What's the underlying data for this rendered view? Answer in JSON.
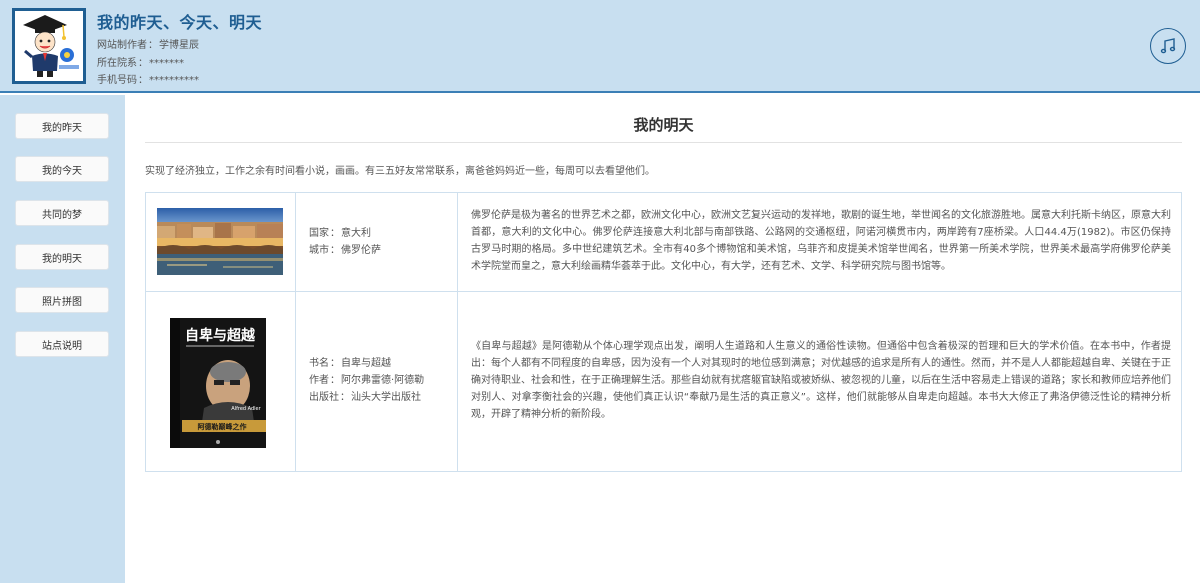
{
  "header": {
    "title": "我的昨天、今天、明天",
    "author_label": "网站制作者",
    "author_value": "学博星辰",
    "dept_label": "所在院系",
    "dept_value": "*******",
    "phone_label": "手机号码",
    "phone_value": "**********",
    "separator": "："
  },
  "sidebar": {
    "items": [
      {
        "label": "我的昨天"
      },
      {
        "label": "我的今天"
      },
      {
        "label": "共同的梦"
      },
      {
        "label": "我的明天"
      },
      {
        "label": "照片拼图"
      },
      {
        "label": "站点说明"
      }
    ]
  },
  "main": {
    "title": "我的明天",
    "intro": "实现了经济独立，工作之余有时间看小说，画画。有三五好友常常联系，离爸爸妈妈近一些，每周可以去看望他们。",
    "rows": [
      {
        "fields": [
          {
            "label": "国家",
            "value": "意大利"
          },
          {
            "label": "城市",
            "value": "佛罗伦萨"
          }
        ],
        "description": "佛罗伦萨是极为著名的世界艺术之都，欧洲文化中心，欧洲文艺复兴运动的发祥地，歌剧的诞生地，举世闻名的文化旅游胜地。属意大利托斯卡纳区，原意大利首都，意大利的文化中心。佛罗伦萨连接意大利北部与南部铁路、公路网的交通枢纽，阿诺河横贯市内，两岸跨有7座桥梁。人口44.4万(1982)。市区仍保持古罗马时期的格局。多中世纪建筑艺术。全市有40多个博物馆和美术馆，乌菲齐和皮提美术馆举世闻名，世界第一所美术学院，世界美术最高学府佛罗伦萨美术学院堂而皇之，意大利绘画精华荟萃于此。文化中心，有大学，还有艺术、文学、科学研究院与图书馆等。"
      },
      {
        "fields": [
          {
            "label": "书名",
            "value": "自卑与超越"
          },
          {
            "label": "作者",
            "value": "阿尔弗雷德·阿德勒"
          },
          {
            "label": "出版社",
            "value": "汕头大学出版社"
          }
        ],
        "description": "《自卑与超越》是阿德勒从个体心理学观点出发，阐明人生道路和人生意义的通俗性读物。但通俗中包含着极深的哲理和巨大的学术价值。在本书中，作者提出：每个人都有不同程度的自卑感，因为没有一个人对其现时的地位感到满意；对优越感的追求是所有人的通性。然而，并不是人人都能超越自卑、关键在于正确对待职业、社会和性，在于正确理解生活。那些自幼就有扰瘩躯官缺陷或被娇纵、被忽视的儿童，以后在生活中容易走上错误的道路；家长和教师应培养他们对别人、对拿李衡社会的兴趣，使他们真正认识“奉献乃是生活的真正意义”。这样，他们就能够从自卑走向超越。本书大大修正了弗洛伊德泛性论的精神分析观，开辟了精神分析的新阶段。",
        "book_cover": {
          "title": "自卑与超越",
          "author_en": "Alfred Adler",
          "banner": "阿德勒巅峰之作"
        }
      }
    ]
  },
  "colors": {
    "header_bg": "#c8dff0",
    "accent": "#1f5e92",
    "border": "#cfe0ee"
  },
  "icons": {
    "music": "music-note-icon"
  }
}
